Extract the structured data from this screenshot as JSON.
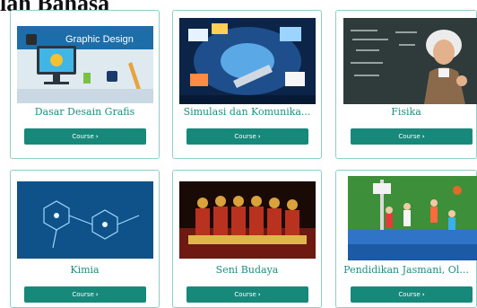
{
  "page": {
    "heading": "lah Bahasa"
  },
  "courses": [
    {
      "title": "Dasar Desain Grafis",
      "button_label": "Course",
      "image": "graphic-design-image",
      "image_text": "Graphic Design"
    },
    {
      "title": "Simulasi dan Komunika...",
      "button_label": "Course",
      "image": "digital-media-image"
    },
    {
      "title": "Fisika",
      "button_label": "Course",
      "image": "einstein-chalkboard-image"
    },
    {
      "title": "Kimia",
      "button_label": "Course",
      "image": "molecule-structure-image"
    },
    {
      "title": "Seni Budaya",
      "button_label": "Course",
      "image": "traditional-dance-image"
    },
    {
      "title": "Pendidikan Jasmani, Ol...",
      "button_label": "Course",
      "image": "kids-basketball-image"
    }
  ],
  "colors": {
    "accent": "#16897a",
    "card_border": "#8fcfc8",
    "title_text": "#1f8f82"
  }
}
